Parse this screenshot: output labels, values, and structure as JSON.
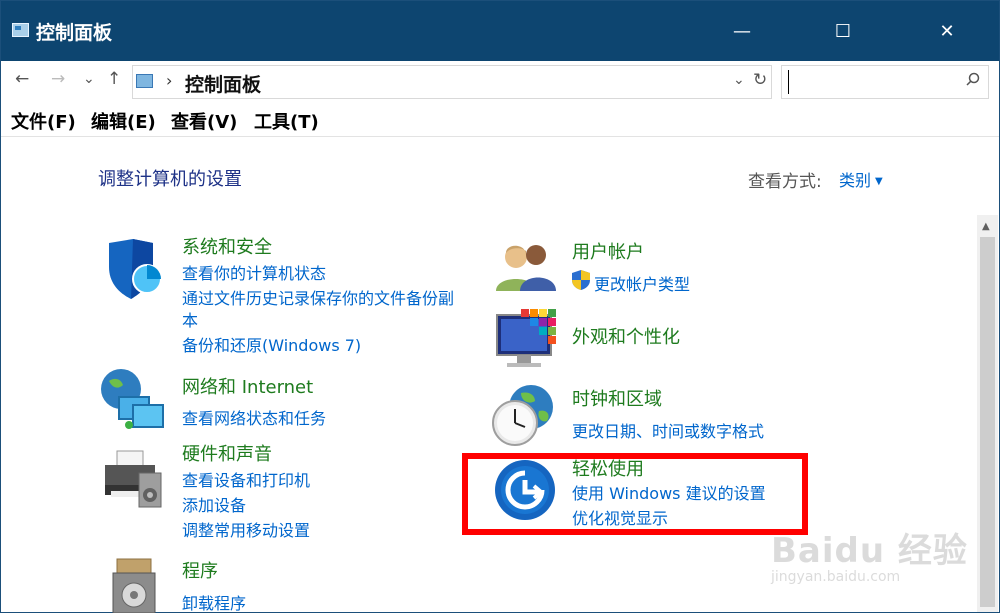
{
  "window": {
    "title": "控制面板",
    "minimize_glyph": "—",
    "maximize_glyph": "☐",
    "close_glyph": "✕"
  },
  "address": {
    "back_glyph": "←",
    "forward_glyph": "→",
    "recent_glyph": "⌄",
    "up_glyph": "↑",
    "separator_glyph": "›",
    "crumb": "控制面板",
    "dropdown_glyph": "⌄",
    "refresh_glyph": "↻",
    "search_value": "",
    "search_icon": "search-icon"
  },
  "menu": [
    "文件(F)",
    "编辑(E)",
    "查看(V)",
    "工具(T)"
  ],
  "main": {
    "heading": "调整计算机的设置",
    "view_by_label": "查看方式:",
    "view_by_value": "类别",
    "categories": [
      {
        "title": "系统和安全",
        "icon": "shield-icon",
        "links": [
          "查看你的计算机状态",
          "通过文件历史记录保存你的文件备份副",
          "本",
          "备份和还原(Windows 7)"
        ]
      },
      {
        "title": "网络和 Internet",
        "icon": "network-globe-icon",
        "links": [
          "查看网络状态和任务"
        ]
      },
      {
        "title": "硬件和声音",
        "icon": "printer-icon",
        "links": [
          "查看设备和打印机",
          "添加设备",
          "调整常用移动设置"
        ]
      },
      {
        "title": "程序",
        "icon": "programs-icon",
        "links": [
          "卸载程序"
        ]
      },
      {
        "title": "用户帐户",
        "icon": "users-icon",
        "links": [
          "更改帐户类型"
        ]
      },
      {
        "title": "外观和个性化",
        "icon": "monitor-colors-icon",
        "links": []
      },
      {
        "title": "时钟和区域",
        "icon": "clock-globe-icon",
        "links": [
          "更改日期、时间或数字格式"
        ]
      },
      {
        "title": "轻松使用",
        "icon": "ease-of-access-icon",
        "links": [
          "使用 Windows 建议的设置",
          "优化视觉显示"
        ]
      }
    ]
  },
  "scrollbar": {
    "up_glyph": "▲"
  },
  "watermark": {
    "text": "Baidu 经验",
    "url": "jingyan.baidu.com"
  },
  "colors": {
    "titlebar": "#0d4570",
    "link": "#0066cc",
    "category_title": "#1e7b1e",
    "heading": "#1e3287",
    "highlight": "#ff0000"
  }
}
